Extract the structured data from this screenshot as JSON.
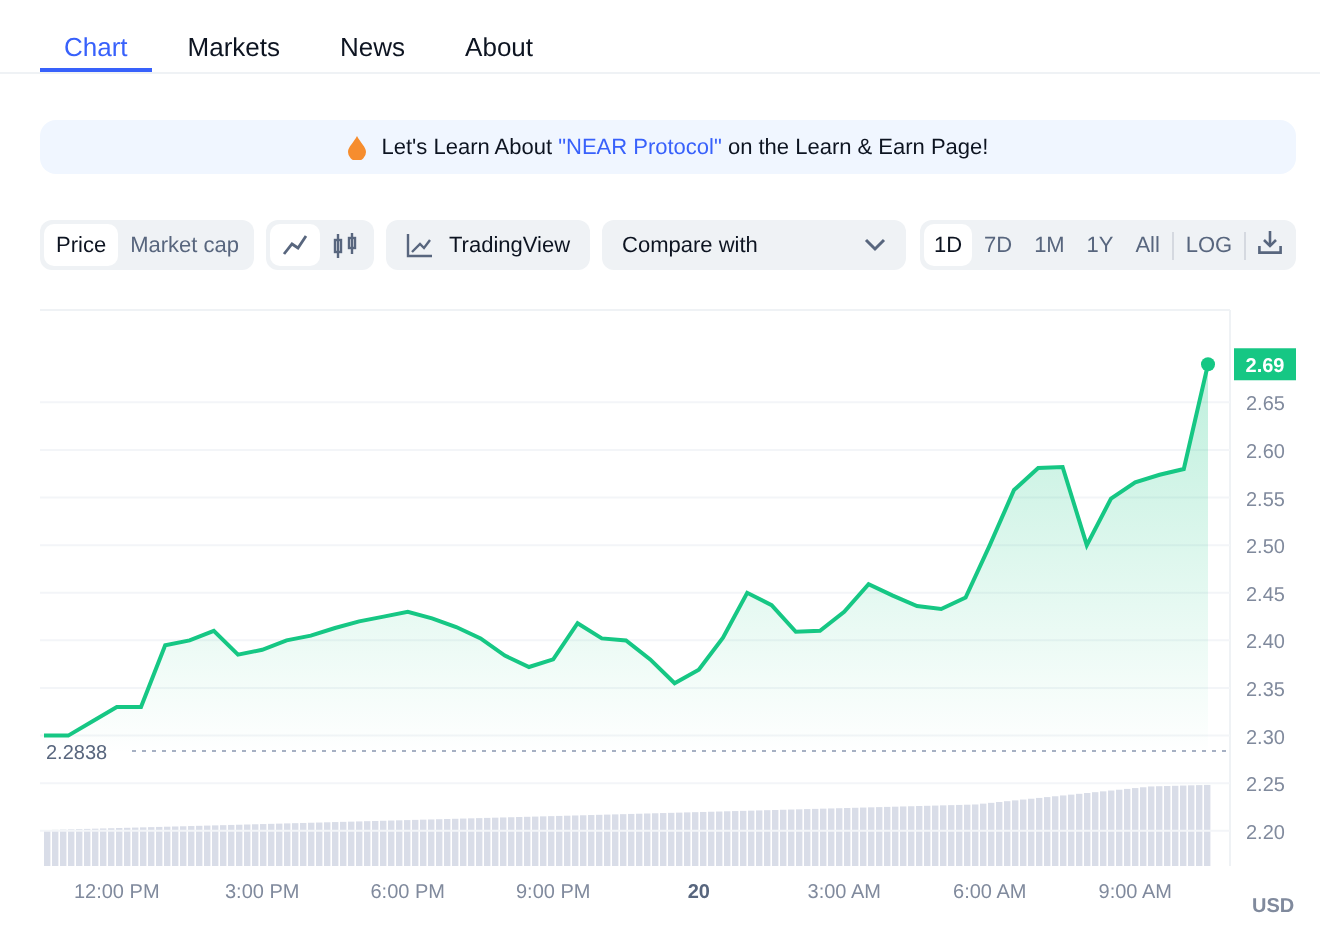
{
  "tabs": [
    {
      "label": "Chart",
      "selected": true
    },
    {
      "label": "Markets",
      "selected": false
    },
    {
      "label": "News",
      "selected": false
    },
    {
      "label": "About",
      "selected": false
    }
  ],
  "banner": {
    "before": "Let's Learn About ",
    "link": "\"NEAR Protocol\"",
    "after": " on the Learn & Earn Page!"
  },
  "toolbar": {
    "metric": [
      {
        "label": "Price",
        "selected": true
      },
      {
        "label": "Market cap",
        "selected": false
      }
    ],
    "chart_type": [
      {
        "kind": "line",
        "selected": true
      },
      {
        "kind": "candle",
        "selected": false
      }
    ],
    "tradingview": "TradingView",
    "compare": "Compare with",
    "ranges": [
      {
        "label": "1D",
        "selected": true
      },
      {
        "label": "7D",
        "selected": false
      },
      {
        "label": "1M",
        "selected": false
      },
      {
        "label": "1Y",
        "selected": false
      },
      {
        "label": "All",
        "selected": false
      }
    ],
    "log": "LOG"
  },
  "chart": {
    "current_price": "2.69",
    "currency": "USD",
    "baseline": "2.2838",
    "chart_data": {
      "type": "area",
      "grid": true,
      "categories": [
        null,
        null,
        null,
        "12:00 PM",
        null,
        null,
        null,
        null,
        null,
        "3:00 PM",
        null,
        null,
        null,
        null,
        null,
        "6:00 PM",
        null,
        null,
        null,
        null,
        null,
        "9:00 PM",
        null,
        null,
        null,
        null,
        null,
        "20",
        null,
        null,
        null,
        null,
        null,
        "3:00 AM",
        null,
        null,
        null,
        null,
        null,
        "6:00 AM",
        null,
        null,
        null,
        null,
        null,
        "9:00 AM",
        null,
        null,
        null
      ],
      "series": [
        {
          "color": "#16c784",
          "values": [
            2.3,
            2.3,
            2.315,
            2.33,
            2.33,
            2.395,
            2.4,
            2.41,
            2.385,
            2.39,
            2.4,
            2.405,
            2.413,
            2.42,
            2.425,
            2.43,
            2.423,
            2.414,
            2.402,
            2.384,
            2.372,
            2.38,
            2.418,
            2.402,
            2.4,
            2.38,
            2.355,
            2.369,
            2.403,
            2.45,
            2.437,
            2.409,
            2.41,
            2.43,
            2.459,
            2.447,
            2.436,
            2.433,
            2.445,
            2.5,
            2.558,
            2.581,
            2.582,
            2.5,
            2.549,
            2.566,
            2.574,
            2.58,
            2.69
          ]
        }
      ],
      "ylim": [
        2.163,
        2.747
      ],
      "yticks": [
        {
          "value": 2.2,
          "label": "2.20"
        },
        2.25,
        {
          "value": 2.3,
          "label": "2.30"
        },
        2.35,
        {
          "value": 2.4,
          "label": "2.40"
        },
        2.45,
        {
          "value": 2.5,
          "label": "2.50"
        },
        2.55,
        {
          "value": 2.6,
          "label": "2.60"
        },
        2.65
      ]
    }
  }
}
